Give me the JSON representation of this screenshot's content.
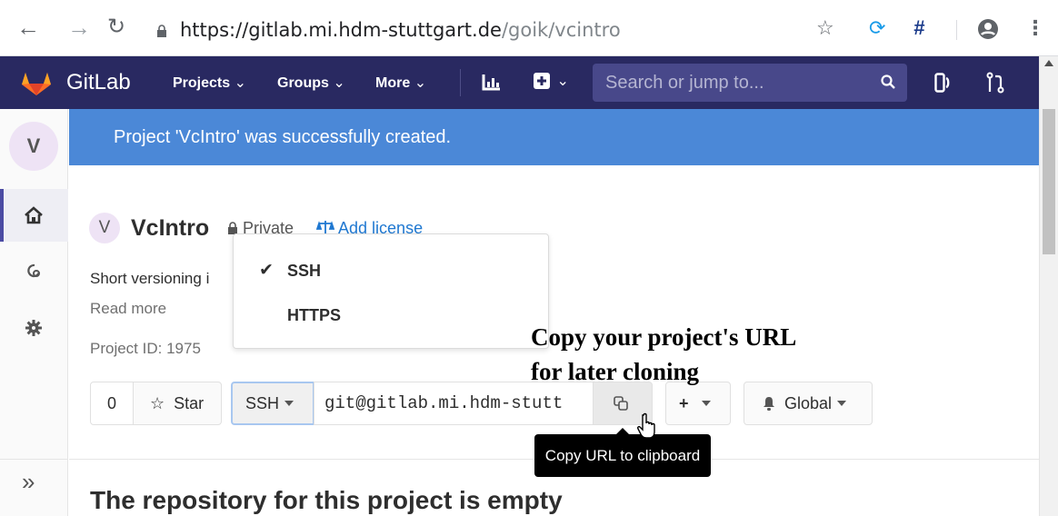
{
  "browser": {
    "url_host": "https://gitlab.mi.hdm-stuttgart.de",
    "url_path": "/goik/vcintro"
  },
  "navbar": {
    "brand": "GitLab",
    "menu": [
      {
        "label": "Projects"
      },
      {
        "label": "Groups"
      },
      {
        "label": "More"
      }
    ],
    "search_placeholder": "Search or jump to..."
  },
  "sidebar": {
    "project_initial": "V"
  },
  "flash": {
    "message": "Project 'VcIntro' was successfully created."
  },
  "project": {
    "avatar_letter": "V",
    "name": "VcIntro",
    "visibility": "Private",
    "add_license": "Add license",
    "description": "Short versioning i",
    "read_more": "Read more",
    "project_id": "Project ID: 1975",
    "star_count": "0",
    "star_label": "Star",
    "clone_protocol": "SSH",
    "clone_url": "git@gitlab.mi.hdm-stutt",
    "notification_label": "Global",
    "add_label": "+"
  },
  "clone_dropdown": {
    "options": [
      {
        "label": "SSH",
        "selected": true
      },
      {
        "label": "HTTPS",
        "selected": false
      }
    ]
  },
  "annotation": {
    "line1": "Copy your project's URL",
    "line2": "for later cloning"
  },
  "tooltip": "Copy URL to clipboard",
  "empty_repo": {
    "title": "The repository for this project is empty"
  },
  "colors": {
    "navbar_bg": "#292961",
    "flash_bg": "#4b88d7",
    "link": "#1f78d1"
  }
}
